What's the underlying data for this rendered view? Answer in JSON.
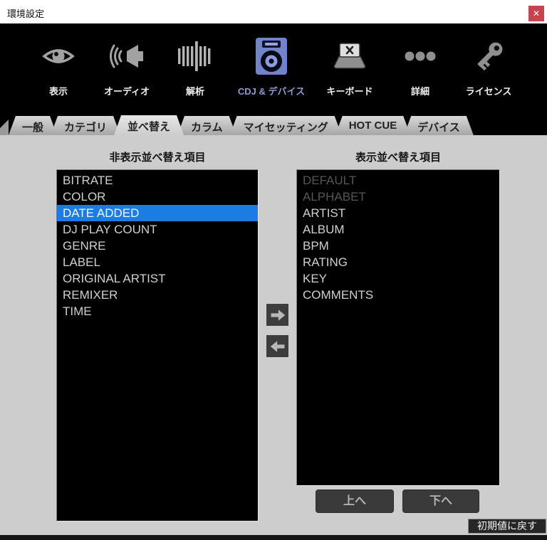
{
  "window": {
    "title": "環境設定",
    "close_glyph": "✕"
  },
  "toolbar": {
    "items": [
      {
        "label": "表示",
        "icon": "eye-icon",
        "selected": false
      },
      {
        "label": "オーディオ",
        "icon": "speaker-icon",
        "selected": false
      },
      {
        "label": "解析",
        "icon": "analysis-bars-icon",
        "selected": false
      },
      {
        "label": "CDJ & デバイス",
        "icon": "cdj-device-icon",
        "selected": true
      },
      {
        "label": "キーボード",
        "icon": "keyboard-icon",
        "selected": false
      },
      {
        "label": "詳細",
        "icon": "ellipsis-icon",
        "selected": false
      },
      {
        "label": "ライセンス",
        "icon": "key-icon",
        "selected": false
      }
    ]
  },
  "tabs": [
    {
      "label": "一般",
      "active": false
    },
    {
      "label": "カテゴリ",
      "active": false
    },
    {
      "label": "並べ替え",
      "active": true
    },
    {
      "label": "カラム",
      "active": false
    },
    {
      "label": "マイセッティング",
      "active": false
    },
    {
      "label": "HOT CUE",
      "active": false
    },
    {
      "label": "デバイス",
      "active": false
    }
  ],
  "sort_panel": {
    "hidden_header": "非表示並べ替え項目",
    "visible_header": "表示並べ替え項目",
    "hidden_items": [
      "BITRATE",
      "COLOR",
      "DATE ADDED",
      "DJ PLAY COUNT",
      "GENRE",
      "LABEL",
      "ORIGINAL ARTIST",
      "REMIXER",
      "TIME"
    ],
    "selected_hidden_item": "DATE ADDED",
    "visible_items": [
      "DEFAULT",
      "ALPHABET",
      "ARTIST",
      "ALBUM",
      "BPM",
      "RATING",
      "KEY",
      "COMMENTS"
    ],
    "disabled_visible_items": [
      "DEFAULT",
      "ALPHABET"
    ],
    "up_label": "上へ",
    "down_label": "下へ",
    "reset_label": "初期値に戻す"
  },
  "colors": {
    "selection_blue": "#1b7de2",
    "accent_label": "#8c9bd4",
    "close_red": "#c5444d",
    "panel_gray": "#cdcdcd"
  }
}
